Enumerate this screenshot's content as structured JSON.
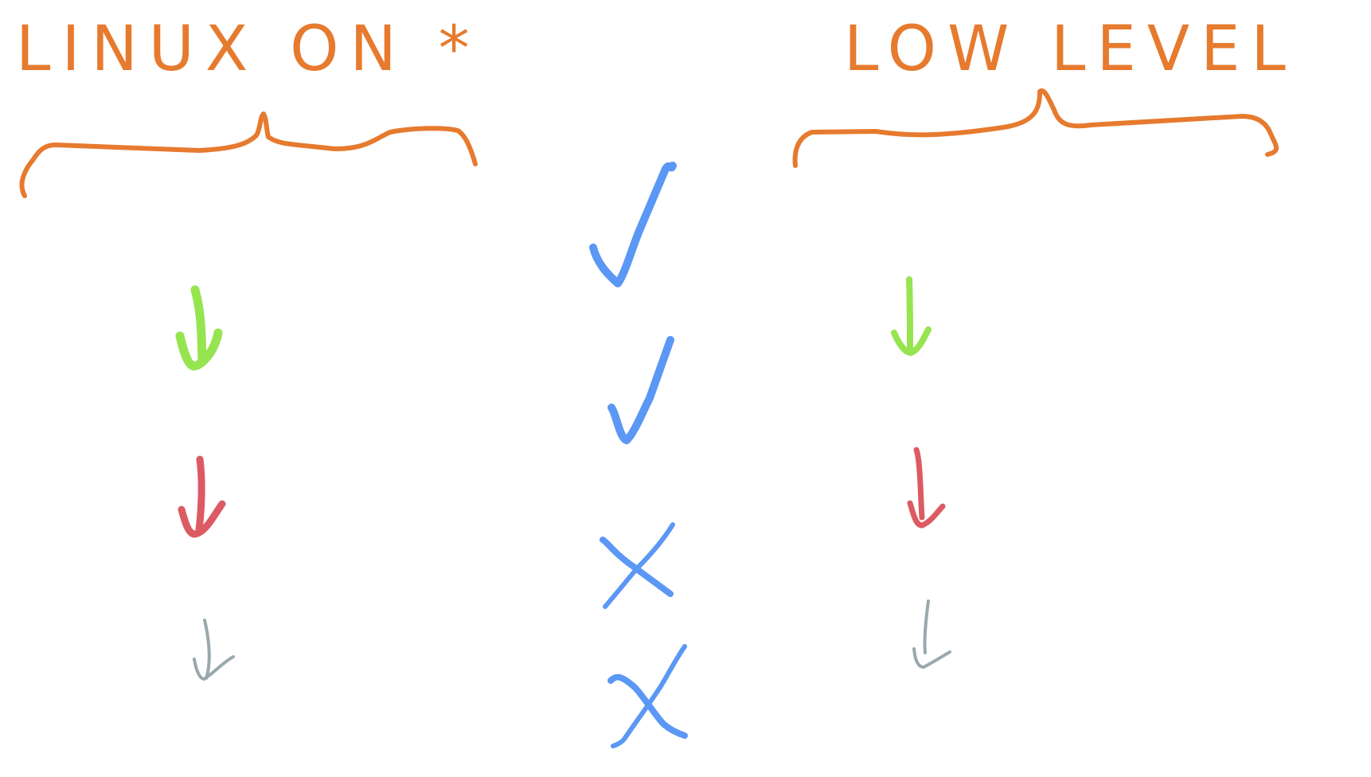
{
  "left_heading": "LINUX ON *",
  "right_heading": "LOW LEVEL",
  "colors": {
    "heading": "#e67a2e",
    "check_mark": "#5b97f5",
    "green": "#96e44f",
    "red": "#dc5a63",
    "gray": "#9aa8ad"
  },
  "marks": {
    "middle": [
      "check-icon",
      "check-icon",
      "x-icon",
      "x-icon"
    ],
    "arrows": [
      "arrow-down-green-icon",
      "arrow-down-red-icon",
      "arrow-down-gray-icon"
    ]
  }
}
